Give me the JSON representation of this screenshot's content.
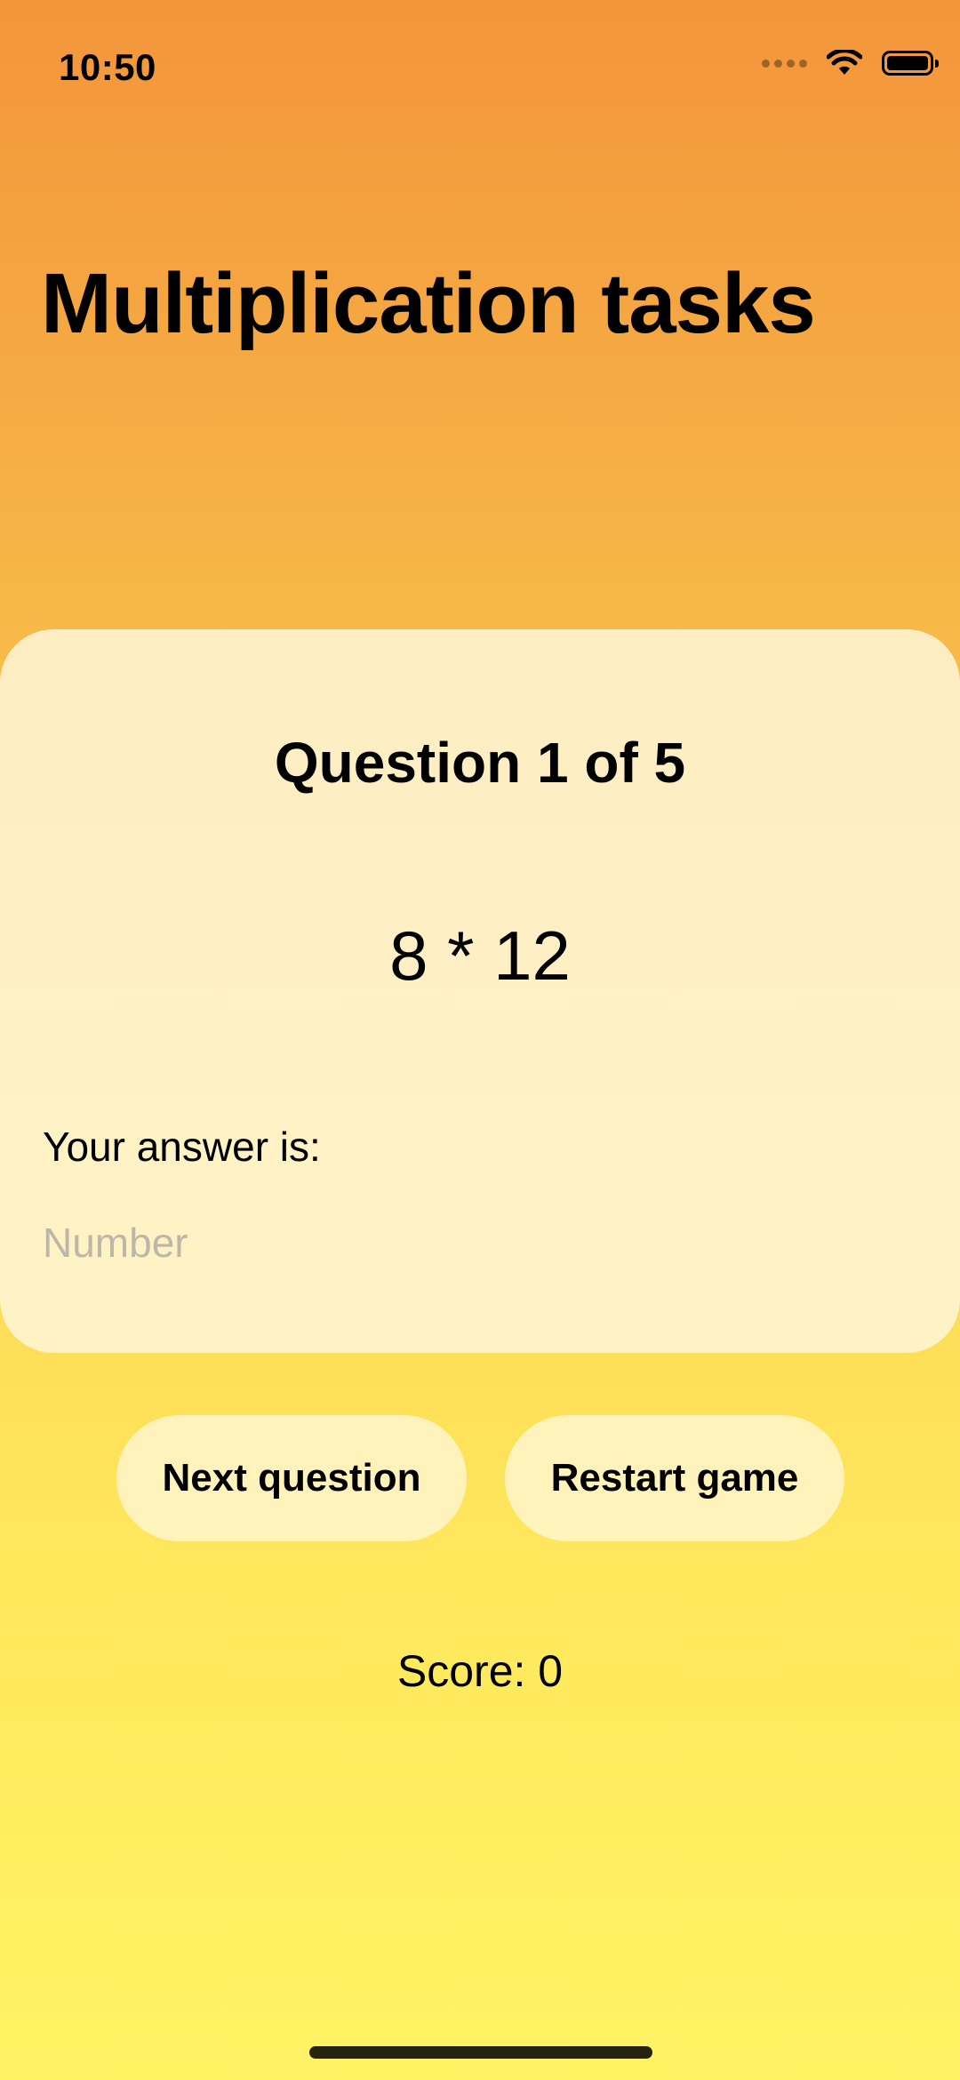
{
  "status_bar": {
    "time": "10:50",
    "icons": [
      "cellular-signal-icon",
      "wifi-icon",
      "battery-icon"
    ]
  },
  "page": {
    "title": "Multiplication tasks"
  },
  "card": {
    "question_header": "Question 1 of 5",
    "question": "8 * 12",
    "answer_label": "Your answer is:",
    "answer_placeholder": "Number",
    "answer_value": ""
  },
  "buttons": {
    "next_label": "Next question",
    "restart_label": "Restart game"
  },
  "score": {
    "text": "Score: 0"
  },
  "colors": {
    "gradient_top": "#f3953b",
    "gradient_bottom": "#fff364",
    "card_background": "#fff8de",
    "placeholder": "#bdb7a8"
  }
}
